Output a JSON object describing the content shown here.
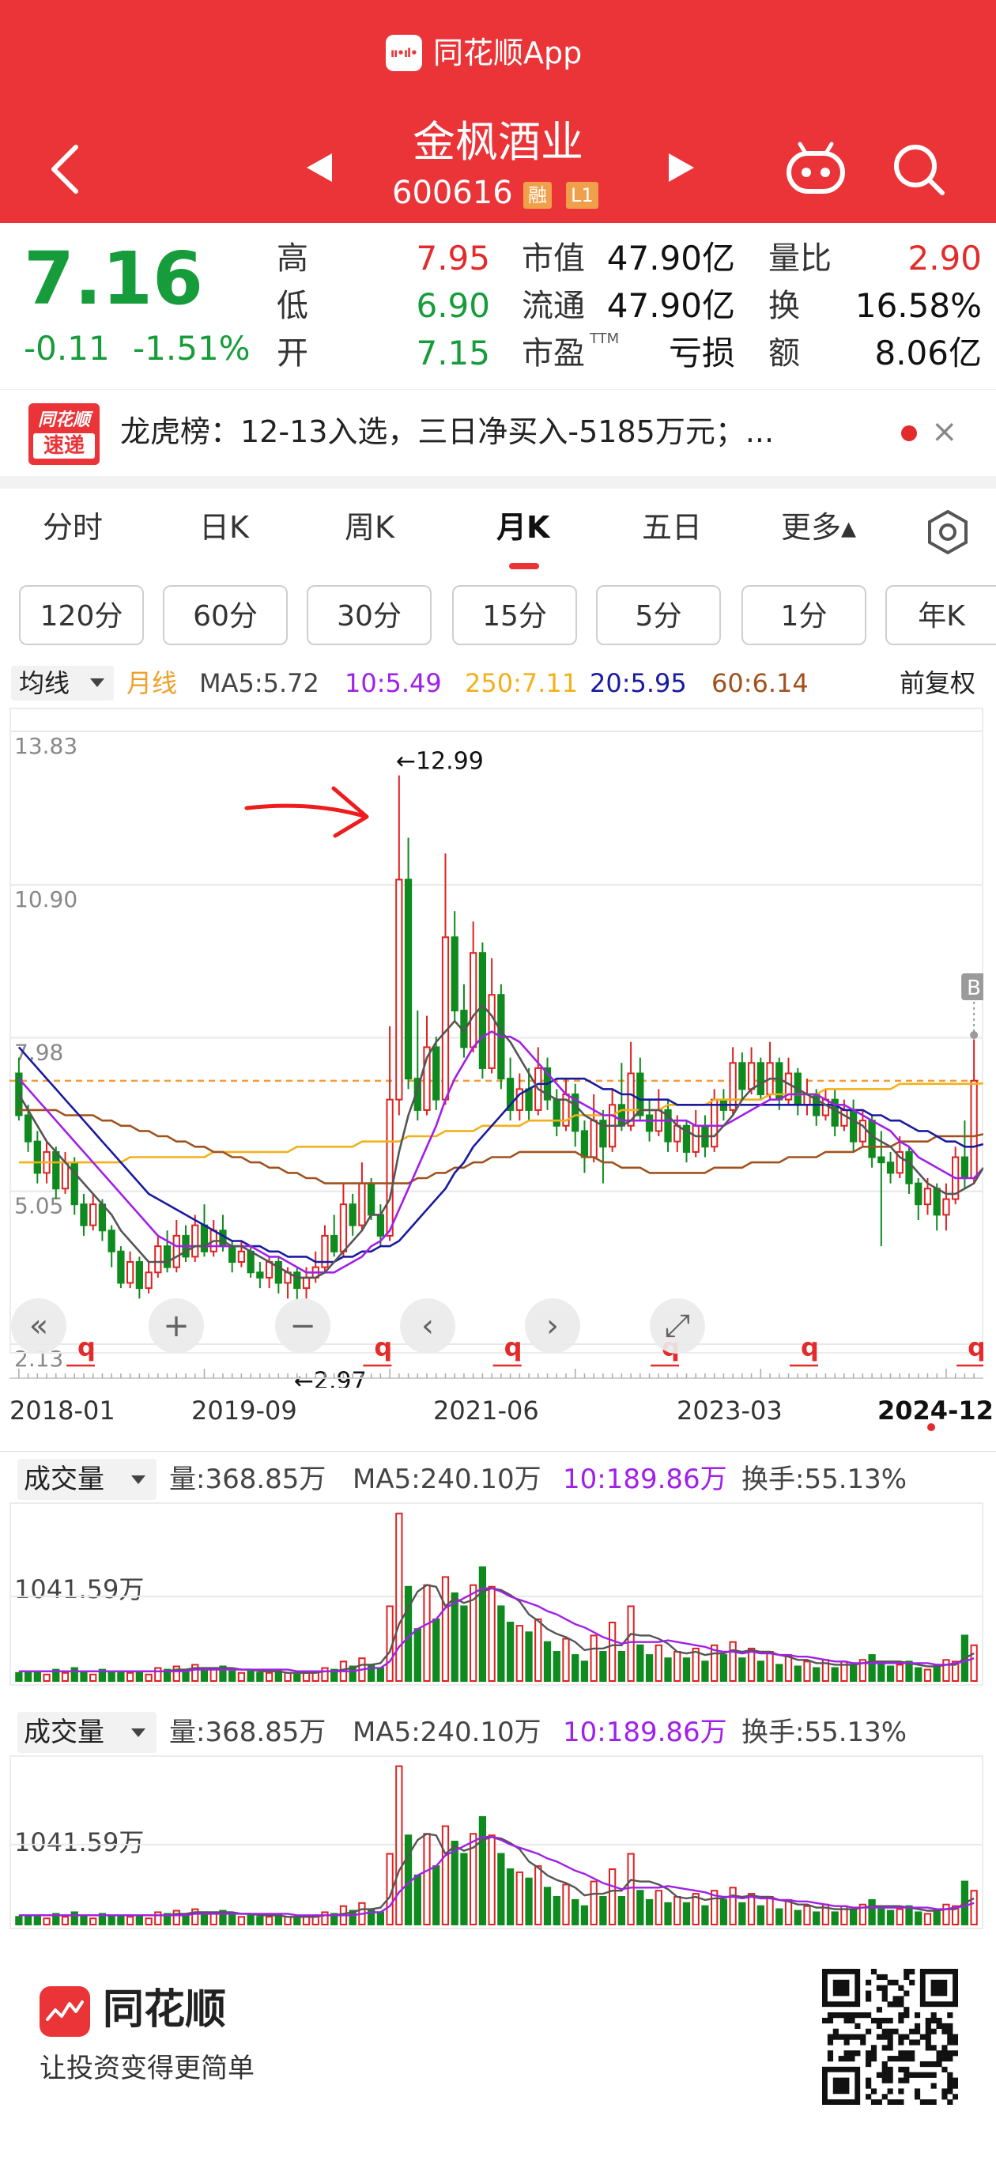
{
  "header": {
    "app_badge_text": "ıı•ıl•",
    "app_name": "同花顺App",
    "stock_name": "金枫酒业",
    "stock_code": "600616",
    "tag_rong": "融",
    "tag_l1": "L1",
    "back_icon": "chevron-left-icon",
    "prev_icon": "triangle-left-icon",
    "next_icon": "triangle-right-icon",
    "robot_icon": "robot-icon",
    "search_icon": "search-icon"
  },
  "quote": {
    "price": "7.16",
    "change": "-0.11",
    "change_pct": "-1.51%",
    "high_label": "高",
    "high": "7.95",
    "low_label": "低",
    "low": "6.90",
    "open_label": "开",
    "open": "7.15",
    "mktcap_label": "市值",
    "mktcap": "47.90亿",
    "float_label": "流通",
    "float": "47.90亿",
    "pe_label": "市盈",
    "pe_sup": "TTM",
    "pe": "亏损",
    "volratio_label": "量比",
    "volratio": "2.90",
    "turnover_label": "换",
    "turnover": "16.58%",
    "amount_label": "额",
    "amount": "8.06亿"
  },
  "news": {
    "logo_top": "同花顺",
    "logo_bottom": "速递",
    "text": "龙虎榜：12-13入选，三日净买入-5185万元；...",
    "close": "×"
  },
  "tabs": [
    "分时",
    "日K",
    "周K",
    "月K",
    "五日",
    "更多▴"
  ],
  "settings_icon": "hexagon-gear-icon",
  "periods": [
    "120分",
    "60分",
    "30分",
    "15分",
    "5分",
    "1分",
    "年K"
  ],
  "ma_legend": {
    "dropdown": "均线",
    "period": "月线",
    "ma5": "MA5:5.72",
    "ma10": "10:5.49",
    "ma250": "250:7.11",
    "ma20": "20:5.95",
    "ma60": "60:6.14",
    "adjust": "前复权"
  },
  "chart_data": {
    "type": "candlestick",
    "title": "",
    "y_ticks": [
      "13.83",
      "10.90",
      "7.98",
      "5.05",
      "2.13"
    ],
    "ylim": [
      2.13,
      13.83
    ],
    "x_labels": [
      "2018-01",
      "2019-09",
      "2021-06",
      "2023-03",
      "2024-12"
    ],
    "annotations": {
      "max_label": "←12.99",
      "min_label": "←2.97",
      "b_marker": "B",
      "q_marker": "q"
    },
    "colors": {
      "up": "#e02020",
      "down": "#0e8a1e",
      "ma5": "#555555",
      "ma10": "#a020e8",
      "ma20": "#1a1aa0",
      "ma60": "#a0521e",
      "ma250": "#f2b11c",
      "price_line": "#f39c3a"
    },
    "candles": [
      [
        7.3,
        6.5,
        7.6,
        6.4
      ],
      [
        6.5,
        6.0,
        6.7,
        5.8
      ],
      [
        6.0,
        5.4,
        6.2,
        5.2
      ],
      [
        5.4,
        5.8,
        6.0,
        5.2
      ],
      [
        5.8,
        5.1,
        5.9,
        4.9
      ],
      [
        5.1,
        5.6,
        5.8,
        5.0
      ],
      [
        5.6,
        4.8,
        5.7,
        4.6
      ],
      [
        4.8,
        4.4,
        5.0,
        4.2
      ],
      [
        4.4,
        4.8,
        5.0,
        4.3
      ],
      [
        4.8,
        4.3,
        4.9,
        4.1
      ],
      [
        4.3,
        3.9,
        4.4,
        3.6
      ],
      [
        3.9,
        3.3,
        4.0,
        3.2
      ],
      [
        3.3,
        3.7,
        3.9,
        3.2
      ],
      [
        3.7,
        3.2,
        3.8,
        3.0
      ],
      [
        3.2,
        3.5,
        3.7,
        3.1
      ],
      [
        3.5,
        4.0,
        4.2,
        3.4
      ],
      [
        4.0,
        3.6,
        4.3,
        3.5
      ],
      [
        3.6,
        4.2,
        4.5,
        3.5
      ],
      [
        4.2,
        3.8,
        4.4,
        3.7
      ],
      [
        3.8,
        4.4,
        4.6,
        3.7
      ],
      [
        4.4,
        3.9,
        4.8,
        3.8
      ],
      [
        3.9,
        4.3,
        4.5,
        3.8
      ],
      [
        4.3,
        4.0,
        4.6,
        3.9
      ],
      [
        4.0,
        3.7,
        4.1,
        3.5
      ],
      [
        3.7,
        3.9,
        4.1,
        3.6
      ],
      [
        3.9,
        3.5,
        4.0,
        3.4
      ],
      [
        3.5,
        3.4,
        3.7,
        3.2
      ],
      [
        3.4,
        3.7,
        3.8,
        3.2
      ],
      [
        3.7,
        3.3,
        3.8,
        3.1
      ],
      [
        3.3,
        3.5,
        3.6,
        3.0
      ],
      [
        3.5,
        3.2,
        3.6,
        2.97
      ],
      [
        3.2,
        3.4,
        3.6,
        3.0
      ],
      [
        3.4,
        3.6,
        3.9,
        3.3
      ],
      [
        3.6,
        4.2,
        4.4,
        3.5
      ],
      [
        4.2,
        3.9,
        4.6,
        3.8
      ],
      [
        3.9,
        4.8,
        5.2,
        3.8
      ],
      [
        4.8,
        4.4,
        5.0,
        4.2
      ],
      [
        4.4,
        5.2,
        5.6,
        4.3
      ],
      [
        5.2,
        4.6,
        5.3,
        4.5
      ],
      [
        4.6,
        4.2,
        4.8,
        4.0
      ],
      [
        4.2,
        6.8,
        8.2,
        4.1
      ],
      [
        6.8,
        11.0,
        12.99,
        6.5
      ],
      [
        11.0,
        7.2,
        11.8,
        7.0
      ],
      [
        7.2,
        6.6,
        8.5,
        6.4
      ],
      [
        6.6,
        7.8,
        8.4,
        6.5
      ],
      [
        7.8,
        6.8,
        8.0,
        6.6
      ],
      [
        6.8,
        9.9,
        11.5,
        6.7
      ],
      [
        9.9,
        8.5,
        10.4,
        8.3
      ],
      [
        8.5,
        7.8,
        9.0,
        7.6
      ],
      [
        7.8,
        9.6,
        10.2,
        7.7
      ],
      [
        9.6,
        7.4,
        9.8,
        7.2
      ],
      [
        7.4,
        8.8,
        9.5,
        7.3
      ],
      [
        8.8,
        7.2,
        9.0,
        7.0
      ],
      [
        7.2,
        6.6,
        7.6,
        6.4
      ],
      [
        6.6,
        7.0,
        7.3,
        6.4
      ],
      [
        7.0,
        6.6,
        7.4,
        6.4
      ],
      [
        6.6,
        7.4,
        7.8,
        6.5
      ],
      [
        7.4,
        6.8,
        7.6,
        6.6
      ],
      [
        6.8,
        6.3,
        7.0,
        6.1
      ],
      [
        6.3,
        6.9,
        7.2,
        6.2
      ],
      [
        6.9,
        6.2,
        7.1,
        5.9
      ],
      [
        6.2,
        5.7,
        6.4,
        5.4
      ],
      [
        5.7,
        6.4,
        6.9,
        5.6
      ],
      [
        6.4,
        5.9,
        6.6,
        5.2
      ],
      [
        5.9,
        6.7,
        7.0,
        5.8
      ],
      [
        6.7,
        6.3,
        7.5,
        6.2
      ],
      [
        6.3,
        7.3,
        7.9,
        6.2
      ],
      [
        7.3,
        6.5,
        7.6,
        6.4
      ],
      [
        6.5,
        6.2,
        6.8,
        6.0
      ],
      [
        6.2,
        6.6,
        7.0,
        6.1
      ],
      [
        6.6,
        6.0,
        6.8,
        5.8
      ],
      [
        6.0,
        6.3,
        6.5,
        5.8
      ],
      [
        6.3,
        5.8,
        6.4,
        5.6
      ],
      [
        5.8,
        6.3,
        6.6,
        5.7
      ],
      [
        6.3,
        5.9,
        6.5,
        5.7
      ],
      [
        5.9,
        6.8,
        7.0,
        5.8
      ],
      [
        6.8,
        6.6,
        7.0,
        6.4
      ],
      [
        6.6,
        7.5,
        7.8,
        6.5
      ],
      [
        7.5,
        7.0,
        7.7,
        6.8
      ],
      [
        7.0,
        7.5,
        7.8,
        6.9
      ],
      [
        7.5,
        6.9,
        7.6,
        6.8
      ],
      [
        6.9,
        7.5,
        7.9,
        6.8
      ],
      [
        7.5,
        6.8,
        7.6,
        6.6
      ],
      [
        6.8,
        7.3,
        7.6,
        6.7
      ],
      [
        7.3,
        6.7,
        7.4,
        6.5
      ],
      [
        6.7,
        6.9,
        7.2,
        6.5
      ],
      [
        6.9,
        6.5,
        7.0,
        6.3
      ],
      [
        6.5,
        6.8,
        7.0,
        6.4
      ],
      [
        6.8,
        6.3,
        7.0,
        6.1
      ],
      [
        6.3,
        6.6,
        6.8,
        6.2
      ],
      [
        6.6,
        6.0,
        6.8,
        5.8
      ],
      [
        6.0,
        6.4,
        6.6,
        5.9
      ],
      [
        6.4,
        5.7,
        6.5,
        5.5
      ],
      [
        5.7,
        5.6,
        6.2,
        4.0
      ],
      [
        5.6,
        5.4,
        5.8,
        5.2
      ],
      [
        5.4,
        5.8,
        6.1,
        5.3
      ],
      [
        5.8,
        5.2,
        5.9,
        5.0
      ],
      [
        5.2,
        4.8,
        5.3,
        4.5
      ],
      [
        4.8,
        5.1,
        5.3,
        4.6
      ],
      [
        5.1,
        4.6,
        5.2,
        4.3
      ],
      [
        4.6,
        4.9,
        5.2,
        4.3
      ],
      [
        4.9,
        5.7,
        5.9,
        4.8
      ],
      [
        5.7,
        5.3,
        6.4,
        5.1
      ],
      [
        5.3,
        7.16,
        7.95,
        5.2
      ]
    ],
    "ma5": [
      6.9,
      6.6,
      6.3,
      6.0,
      5.8,
      5.6,
      5.4,
      5.2,
      5.0,
      4.8,
      4.6,
      4.3,
      4.1,
      3.9,
      3.7,
      3.7,
      3.7,
      3.8,
      3.9,
      4.0,
      4.0,
      4.1,
      4.1,
      4.0,
      4.0,
      3.9,
      3.8,
      3.7,
      3.6,
      3.5,
      3.4,
      3.4,
      3.4,
      3.5,
      3.7,
      3.9,
      4.1,
      4.3,
      4.6,
      4.6,
      4.9,
      5.8,
      6.5,
      7.0,
      7.6,
      7.9,
      8.1,
      8.3,
      8.1,
      8.4,
      8.6,
      8.4,
      8.1,
      7.9,
      7.6,
      7.3,
      7.0,
      6.9,
      6.8,
      6.8,
      6.7,
      6.5,
      6.4,
      6.3,
      6.3,
      6.3,
      6.4,
      6.6,
      6.6,
      6.6,
      6.5,
      6.3,
      6.2,
      6.1,
      6.1,
      6.1,
      6.3,
      6.5,
      6.8,
      7.0,
      7.1,
      7.2,
      7.2,
      7.1,
      7.0,
      6.9,
      6.8,
      6.7,
      6.6,
      6.5,
      6.4,
      6.3,
      6.1,
      6.0,
      5.9,
      5.7,
      5.6,
      5.4,
      5.2,
      5.1,
      5.0,
      5.0,
      5.1,
      5.2,
      5.5
    ],
    "ma10": [
      7.2,
      7.0,
      6.8,
      6.6,
      6.4,
      6.2,
      6.0,
      5.8,
      5.6,
      5.4,
      5.2,
      5.0,
      4.8,
      4.6,
      4.4,
      4.2,
      4.1,
      4.0,
      4.0,
      4.0,
      4.0,
      4.0,
      4.0,
      4.0,
      4.0,
      4.0,
      3.9,
      3.8,
      3.8,
      3.7,
      3.6,
      3.5,
      3.5,
      3.5,
      3.5,
      3.6,
      3.7,
      3.8,
      4.0,
      4.1,
      4.3,
      4.7,
      5.1,
      5.5,
      5.9,
      6.3,
      6.8,
      7.2,
      7.5,
      7.8,
      8.0,
      8.1,
      8.0,
      8.0,
      7.9,
      7.7,
      7.5,
      7.3,
      7.1,
      6.9,
      6.8,
      6.7,
      6.6,
      6.5,
      6.5,
      6.4,
      6.4,
      6.4,
      6.4,
      6.4,
      6.4,
      6.4,
      6.4,
      6.3,
      6.3,
      6.3,
      6.3,
      6.4,
      6.5,
      6.6,
      6.7,
      6.8,
      6.8,
      6.9,
      6.9,
      6.9,
      6.9,
      6.8,
      6.7,
      6.7,
      6.6,
      6.5,
      6.4,
      6.3,
      6.2,
      6.0,
      5.9,
      5.7,
      5.6,
      5.5,
      5.4,
      5.3,
      5.3,
      5.3,
      5.49
    ],
    "ma20": [
      7.8,
      7.6,
      7.4,
      7.2,
      7.0,
      6.8,
      6.6,
      6.4,
      6.2,
      6.0,
      5.8,
      5.6,
      5.4,
      5.2,
      5.0,
      4.9,
      4.8,
      4.7,
      4.6,
      4.5,
      4.4,
      4.3,
      4.2,
      4.1,
      4.1,
      4.0,
      4.0,
      3.9,
      3.9,
      3.8,
      3.8,
      3.8,
      3.7,
      3.7,
      3.7,
      3.8,
      3.8,
      3.9,
      3.9,
      4.0,
      4.0,
      4.1,
      4.3,
      4.5,
      4.7,
      4.9,
      5.1,
      5.4,
      5.6,
      5.9,
      6.1,
      6.3,
      6.5,
      6.7,
      6.9,
      7.0,
      7.1,
      7.1,
      7.2,
      7.2,
      7.2,
      7.2,
      7.1,
      7.0,
      7.0,
      6.9,
      6.9,
      6.8,
      6.8,
      6.8,
      6.8,
      6.7,
      6.7,
      6.7,
      6.7,
      6.7,
      6.7,
      6.7,
      6.7,
      6.7,
      6.7,
      6.7,
      6.7,
      6.7,
      6.7,
      6.7,
      6.7,
      6.7,
      6.7,
      6.6,
      6.6,
      6.6,
      6.5,
      6.5,
      6.4,
      6.4,
      6.3,
      6.2,
      6.2,
      6.1,
      6.0,
      6.0,
      5.9,
      5.9,
      5.95
    ],
    "ma60": [
      6.6,
      6.6,
      6.6,
      6.6,
      6.6,
      6.5,
      6.5,
      6.5,
      6.5,
      6.4,
      6.4,
      6.3,
      6.3,
      6.2,
      6.2,
      6.1,
      6.1,
      6.0,
      6.0,
      5.9,
      5.9,
      5.8,
      5.8,
      5.7,
      5.7,
      5.6,
      5.6,
      5.5,
      5.5,
      5.4,
      5.4,
      5.3,
      5.3,
      5.2,
      5.2,
      5.2,
      5.2,
      5.2,
      5.2,
      5.2,
      5.2,
      5.2,
      5.2,
      5.3,
      5.3,
      5.4,
      5.4,
      5.5,
      5.5,
      5.6,
      5.6,
      5.7,
      5.7,
      5.7,
      5.8,
      5.8,
      5.8,
      5.8,
      5.8,
      5.8,
      5.8,
      5.7,
      5.7,
      5.6,
      5.6,
      5.5,
      5.5,
      5.5,
      5.4,
      5.4,
      5.4,
      5.4,
      5.4,
      5.4,
      5.4,
      5.5,
      5.5,
      5.5,
      5.5,
      5.6,
      5.6,
      5.6,
      5.6,
      5.7,
      5.7,
      5.7,
      5.7,
      5.8,
      5.8,
      5.8,
      5.8,
      5.9,
      5.9,
      5.9,
      5.9,
      6.0,
      6.0,
      6.0,
      6.0,
      6.1,
      6.1,
      6.1,
      6.1,
      6.1,
      6.14
    ],
    "ma250": [
      5.6,
      5.6,
      5.6,
      5.6,
      5.6,
      5.6,
      5.6,
      5.6,
      5.6,
      5.6,
      5.6,
      5.6,
      5.7,
      5.7,
      5.7,
      5.7,
      5.7,
      5.7,
      5.7,
      5.7,
      5.7,
      5.8,
      5.8,
      5.8,
      5.8,
      5.8,
      5.8,
      5.8,
      5.8,
      5.8,
      5.9,
      5.9,
      5.9,
      5.9,
      5.9,
      5.9,
      5.9,
      6.0,
      6.0,
      6.0,
      6.0,
      6.0,
      6.1,
      6.1,
      6.1,
      6.1,
      6.2,
      6.2,
      6.2,
      6.2,
      6.3,
      6.3,
      6.3,
      6.3,
      6.3,
      6.4,
      6.4,
      6.4,
      6.4,
      6.4,
      6.5,
      6.5,
      6.5,
      6.5,
      6.5,
      6.6,
      6.6,
      6.6,
      6.6,
      6.6,
      6.7,
      6.7,
      6.7,
      6.7,
      6.7,
      6.8,
      6.8,
      6.8,
      6.8,
      6.8,
      6.8,
      6.9,
      6.9,
      6.9,
      6.9,
      6.9,
      6.9,
      7.0,
      7.0,
      7.0,
      7.0,
      7.0,
      7.0,
      7.0,
      7.0,
      7.1,
      7.1,
      7.1,
      7.1,
      7.1,
      7.1,
      7.1,
      7.1,
      7.1,
      7.11
    ],
    "volume": [
      0.5,
      0.6,
      0.6,
      0.4,
      0.7,
      0.5,
      0.8,
      0.6,
      0.4,
      0.7,
      0.5,
      0.6,
      0.5,
      0.6,
      0.4,
      0.8,
      0.7,
      0.9,
      0.6,
      1.0,
      0.8,
      0.7,
      0.9,
      0.6,
      0.5,
      0.6,
      0.5,
      0.5,
      0.6,
      0.5,
      0.4,
      0.5,
      0.6,
      0.8,
      0.7,
      1.2,
      0.9,
      1.4,
      1.0,
      0.8,
      4.6,
      10.3,
      5.8,
      3.2,
      5.9,
      3.8,
      6.4,
      5.4,
      4.6,
      5.9,
      7.0,
      5.8,
      4.6,
      3.6,
      3.4,
      3.0,
      3.8,
      2.4,
      1.8,
      2.6,
      1.6,
      1.2,
      2.8,
      1.8,
      3.6,
      1.8,
      4.6,
      2.2,
      1.6,
      2.2,
      1.4,
      1.8,
      1.4,
      2.0,
      1.2,
      2.2,
      1.6,
      2.4,
      1.4,
      2.0,
      1.2,
      1.8,
      1.0,
      1.6,
      0.9,
      1.2,
      0.8,
      1.3,
      0.8,
      1.2,
      1.0,
      1.3,
      1.6,
      1.0,
      0.9,
      1.0,
      1.2,
      0.8,
      0.7,
      1.0,
      1.3,
      1.2,
      2.8,
      2.2
    ],
    "vol_ma5": [
      0.6,
      0.6,
      0.6,
      0.6,
      0.6,
      0.6,
      0.6,
      0.6,
      0.6,
      0.6,
      0.6,
      0.6,
      0.6,
      0.6,
      0.6,
      0.6,
      0.6,
      0.7,
      0.7,
      0.8,
      0.8,
      0.8,
      0.8,
      0.8,
      0.7,
      0.7,
      0.6,
      0.6,
      0.6,
      0.5,
      0.5,
      0.5,
      0.5,
      0.6,
      0.6,
      0.7,
      0.8,
      1.0,
      1.0,
      1.1,
      1.8,
      3.5,
      4.5,
      5.5,
      5.9,
      5.8,
      4.6,
      5.1,
      4.8,
      5.0,
      5.5,
      5.7,
      5.6,
      5.3,
      4.9,
      4.1,
      3.7,
      3.2,
      2.9,
      2.7,
      2.4,
      1.9,
      2.0,
      2.0,
      2.2,
      2.2,
      2.9,
      2.8,
      2.8,
      2.6,
      2.3,
      1.8,
      1.7,
      1.8,
      1.6,
      1.7,
      1.7,
      1.9,
      1.8,
      1.9,
      1.8,
      1.8,
      1.6,
      1.5,
      1.3,
      1.3,
      1.1,
      1.1,
      1.0,
      1.0,
      1.0,
      1.1,
      1.2,
      1.2,
      1.2,
      1.2,
      1.1,
      1.0,
      0.9,
      0.9,
      1.0,
      1.0,
      1.4,
      1.7
    ],
    "vol_ma10": [
      0.6,
      0.6,
      0.6,
      0.6,
      0.6,
      0.6,
      0.6,
      0.6,
      0.6,
      0.6,
      0.6,
      0.6,
      0.6,
      0.6,
      0.6,
      0.6,
      0.6,
      0.6,
      0.6,
      0.7,
      0.7,
      0.7,
      0.7,
      0.7,
      0.7,
      0.7,
      0.7,
      0.7,
      0.7,
      0.7,
      0.6,
      0.6,
      0.6,
      0.6,
      0.6,
      0.6,
      0.6,
      0.7,
      0.8,
      0.8,
      1.2,
      2.1,
      2.7,
      3.2,
      3.5,
      3.8,
      4.5,
      4.8,
      5.1,
      5.4,
      5.7,
      5.7,
      5.5,
      5.2,
      5.0,
      4.8,
      4.6,
      4.3,
      4.1,
      3.8,
      3.5,
      3.3,
      3.0,
      2.7,
      2.5,
      2.3,
      2.4,
      2.4,
      2.4,
      2.4,
      2.5,
      2.4,
      2.3,
      2.2,
      2.1,
      1.9,
      1.8,
      1.8,
      1.7,
      1.8,
      1.7,
      1.7,
      1.6,
      1.6,
      1.5,
      1.5,
      1.4,
      1.3,
      1.2,
      1.2,
      1.1,
      1.1,
      1.1,
      1.1,
      1.1,
      1.1,
      1.1,
      1.1,
      1.1,
      1.0,
      1.0,
      1.1,
      1.2,
      1.4
    ]
  },
  "volume_panel": {
    "dropdown": "成交量",
    "vol": "量:368.85万",
    "ma5": "MA5:240.10万",
    "ma10": "10:189.86万",
    "turnover": "换手:55.13%",
    "level": "1041.59万"
  },
  "chart_buttons": [
    "«",
    "+",
    "−",
    "‹",
    "›",
    "⤢"
  ],
  "footer": {
    "logo_name": "同花顺",
    "slogan": "让投资变得更简单",
    "qr_icon": "qr-code-icon"
  }
}
